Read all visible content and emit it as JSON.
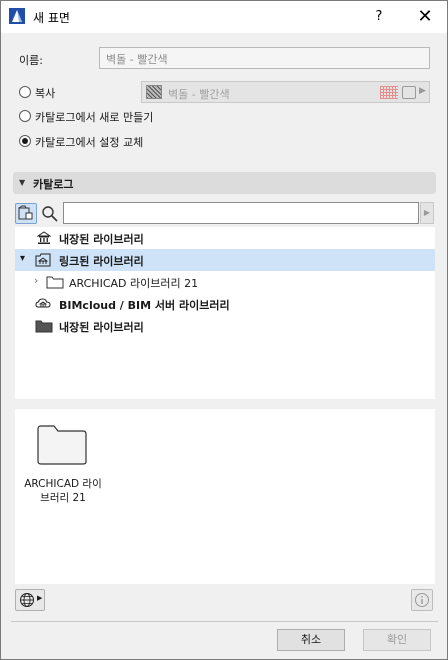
{
  "window": {
    "title": "새 표면",
    "help_label": "?",
    "close_label": "✕"
  },
  "form": {
    "name_label": "이름:",
    "name_value": "벽돌 - 빨간색"
  },
  "options": [
    {
      "label": "복사",
      "checked": false
    },
    {
      "label": "카탈로그에서 새로 만들기",
      "checked": false
    },
    {
      "label": "카탈로그에서 설정 교체",
      "checked": true
    }
  ],
  "copy_source": {
    "value": "벽돌 - 빨간색"
  },
  "catalog": {
    "title": "카탈로그",
    "search_value": "",
    "tree": [
      {
        "label": "내장된 라이브러리",
        "icon": "library-icon",
        "bold": true,
        "selected": false,
        "expand": ""
      },
      {
        "label": "링크된 라이브러리",
        "icon": "linked-library-icon",
        "bold": true,
        "selected": true,
        "expand": "expanded"
      },
      {
        "label": "ARCHICAD 라이브러리 21",
        "icon": "folder-icon",
        "bold": false,
        "selected": false,
        "expand": "collapsed"
      },
      {
        "label": "BIMcloud / BIM 서버 라이브러리",
        "icon": "bimcloud-library-icon",
        "bold": true,
        "selected": false,
        "expand": ""
      },
      {
        "label": "내장된 라이브러리",
        "icon": "folder-filled-icon",
        "bold": true,
        "selected": false,
        "expand": ""
      }
    ]
  },
  "preview": {
    "label_line1": "ARCHICAD 라이",
    "label_line2": "브러리 21"
  },
  "footer": {
    "cancel_label": "취소",
    "ok_label": "확인"
  }
}
